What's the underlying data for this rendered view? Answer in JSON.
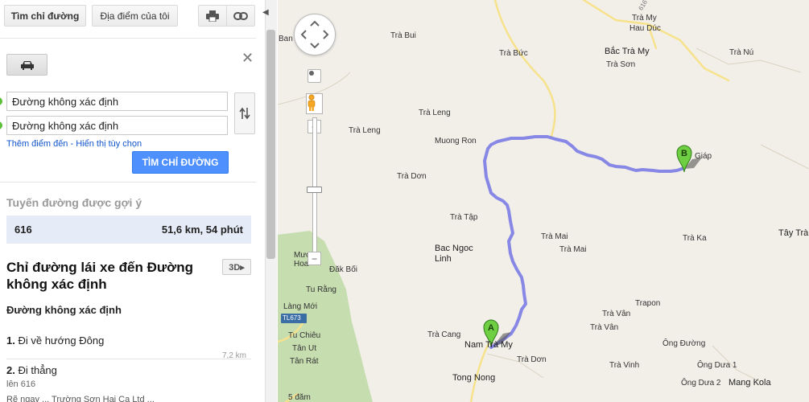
{
  "toolbar": {
    "directions_label": "Tìm chỉ đường",
    "my_places_label": "Địa điểm của tôi",
    "print_icon": "print-icon",
    "link_icon": "link-icon"
  },
  "directions_form": {
    "mode_icon": "car-icon",
    "origin_value": "Đường không xác định",
    "destination_value": "Đường không xác định",
    "add_destination_link": "Thêm điểm đến",
    "separator": " - ",
    "show_options_link": "Hiển thị tùy chọn",
    "submit_label": "TÌM CHỈ ĐƯỜNG"
  },
  "suggested": {
    "title": "Tuyến đường được gợi ý",
    "route_name": "616",
    "route_summary": "51,6 km, 54 phút"
  },
  "directions": {
    "title": "Chỉ đường lái xe đến Đường không xác định",
    "button_3d": "3D▸",
    "start_name": "Đường không xác định",
    "steps": [
      {
        "num": "1.",
        "text": "Đi về hướng ",
        "bold": "Đông",
        "distance": "7,2 km"
      },
      {
        "num": "2.",
        "text": "Đi thẳng",
        "sub": "lên 616"
      }
    ],
    "step3_partial": "Rẽ ngay ... Trường Sơn Hai Ca Ltd ..."
  },
  "map": {
    "route_color": "#7b7be6",
    "marker_a": "A",
    "marker_b": "B",
    "labels": {
      "tra_my": "Trà My",
      "hau_duc": "Hau Dúc",
      "bac_tra_my": "Bắc Trà My",
      "tra_son": "Trà Sơn",
      "tra_nu": "Trà Nú",
      "tra_bui": "Trà Bui",
      "tra_buc": "Trà Bức",
      "ban": "Ban",
      "tra_leng_1": "Trà Leng",
      "tra_leng_2": "Trà Leng",
      "muong_ron": "Muong Ron",
      "tra_don_1": "Trà Dơn",
      "giap": "Giáp",
      "tra_tap": "Trà Tập",
      "bac_ngoc_linh": "Bac Ngoc\nLinh",
      "tra_mai_1": "Trà Mai",
      "tra_mai_2": "Trà Mai",
      "tra_ka": "Trà Ka",
      "tay_tra": "Tây Trà",
      "muong_hoa": "Mươ\nHoa",
      "dak_boi": "Đăk Bối",
      "tu_rang": "Tu Rằng",
      "lang_moi": "Làng Mới",
      "tl673": "TL673",
      "tu_chieu": "Tu Chiêu",
      "tan_ut": "Tân Ut",
      "tan_rat": "Tân Rát",
      "trapon": "Trapon",
      "tra_van_1": "Trà Vân",
      "tra_van_2": "Trà Vân",
      "tra_cang": "Trà Cang",
      "nam_tra_my": "Nam Trà My",
      "tra_don_2": "Trà Dơn",
      "ong_duong": "Ông Đường",
      "tra_vinh": "Trà Vinh",
      "ong_dua_1": "Ông Dưa 1",
      "ong_dua_2": "Ông Dưa 2",
      "mang_kola": "Mang Kola",
      "tong_nong": "Tong Nong",
      "nam_dam": "5 đăm",
      "road616": "616"
    }
  }
}
